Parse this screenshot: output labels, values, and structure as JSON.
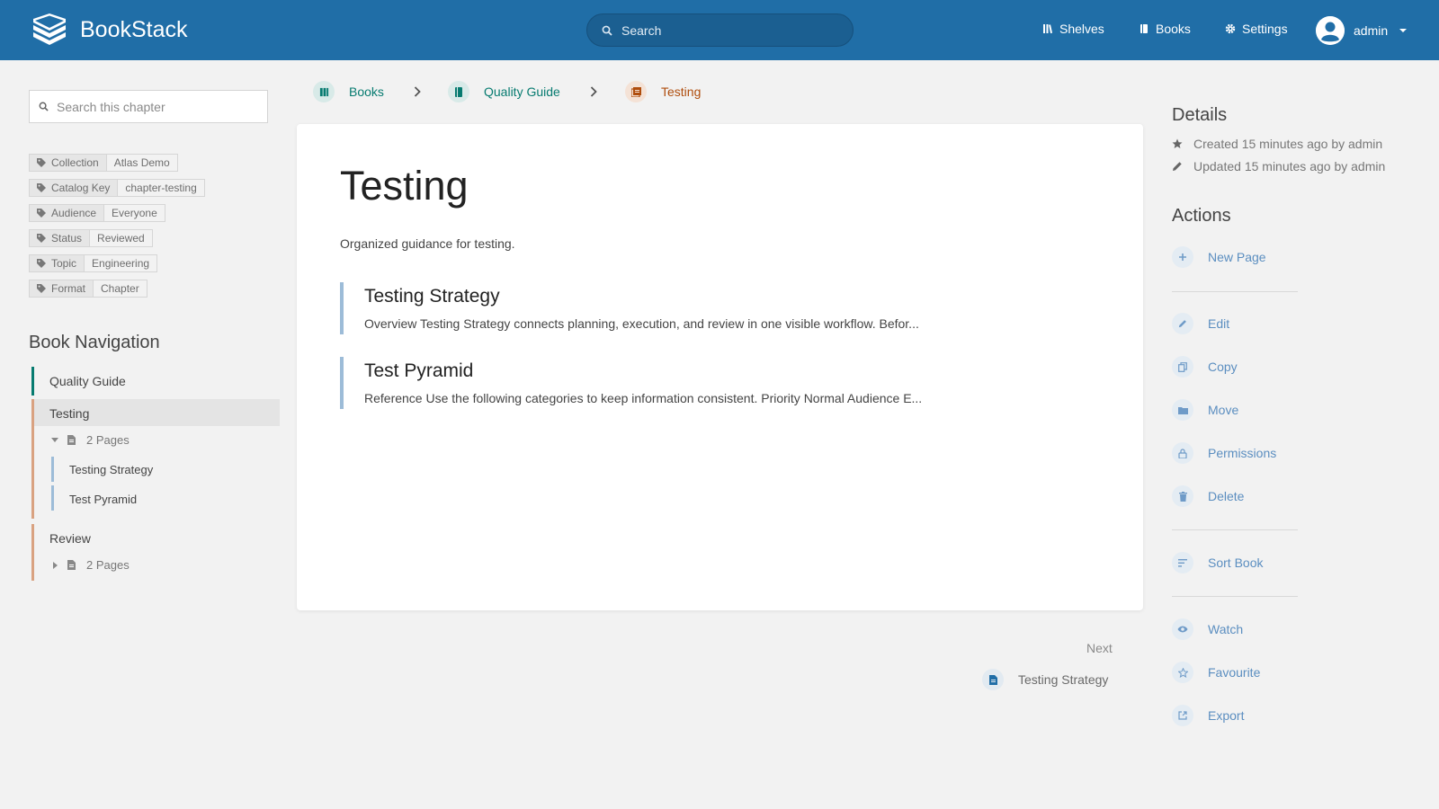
{
  "header": {
    "app_name": "BookStack",
    "search_placeholder": "Search",
    "nav": [
      {
        "label": "Shelves",
        "icon": "shelves-icon"
      },
      {
        "label": "Books",
        "icon": "books-icon"
      },
      {
        "label": "Settings",
        "icon": "gear-icon"
      }
    ],
    "user": "admin"
  },
  "sidebar": {
    "search_placeholder": "Search this chapter",
    "tags": [
      {
        "name": "Collection",
        "value": "Atlas Demo"
      },
      {
        "name": "Catalog Key",
        "value": "chapter-testing"
      },
      {
        "name": "Audience",
        "value": "Everyone"
      },
      {
        "name": "Status",
        "value": "Reviewed"
      },
      {
        "name": "Topic",
        "value": "Engineering"
      },
      {
        "name": "Format",
        "value": "Chapter"
      }
    ],
    "book_nav": {
      "title": "Book Navigation",
      "book": "Quality Guide",
      "chapters": [
        {
          "label": "Testing",
          "pages_count": "2 Pages",
          "pages": [
            "Testing Strategy",
            "Test Pyramid"
          ]
        },
        {
          "label": "Review",
          "pages_count": "2 Pages"
        }
      ]
    }
  },
  "breadcrumb": {
    "items": [
      "Books",
      "Quality Guide",
      "Testing"
    ]
  },
  "main": {
    "title": "Testing",
    "description": "Organized guidance for testing.",
    "entries": [
      {
        "title": "Testing Strategy",
        "excerpt": "Overview Testing Strategy connects planning, execution, and review in one visible workflow. Befor..."
      },
      {
        "title": "Test Pyramid",
        "excerpt": "Reference Use the following categories to keep information consistent. Priority Normal Audience E..."
      }
    ],
    "next_label": "Next",
    "next_page": "Testing Strategy"
  },
  "details": {
    "title": "Details",
    "created": "Created 15 minutes ago by admin",
    "updated": "Updated 15 minutes ago by admin"
  },
  "actions": {
    "title": "Actions",
    "new_page": "New Page",
    "edit": "Edit",
    "copy": "Copy",
    "move": "Move",
    "permissions": "Permissions",
    "delete": "Delete",
    "sort_book": "Sort Book",
    "watch": "Watch",
    "favourite": "Favourite",
    "export": "Export"
  },
  "colors": {
    "header": "#206ea7",
    "book": "#077b70",
    "chapter": "#af4d0d",
    "page": "#206ea7",
    "link": "#206ea7"
  }
}
